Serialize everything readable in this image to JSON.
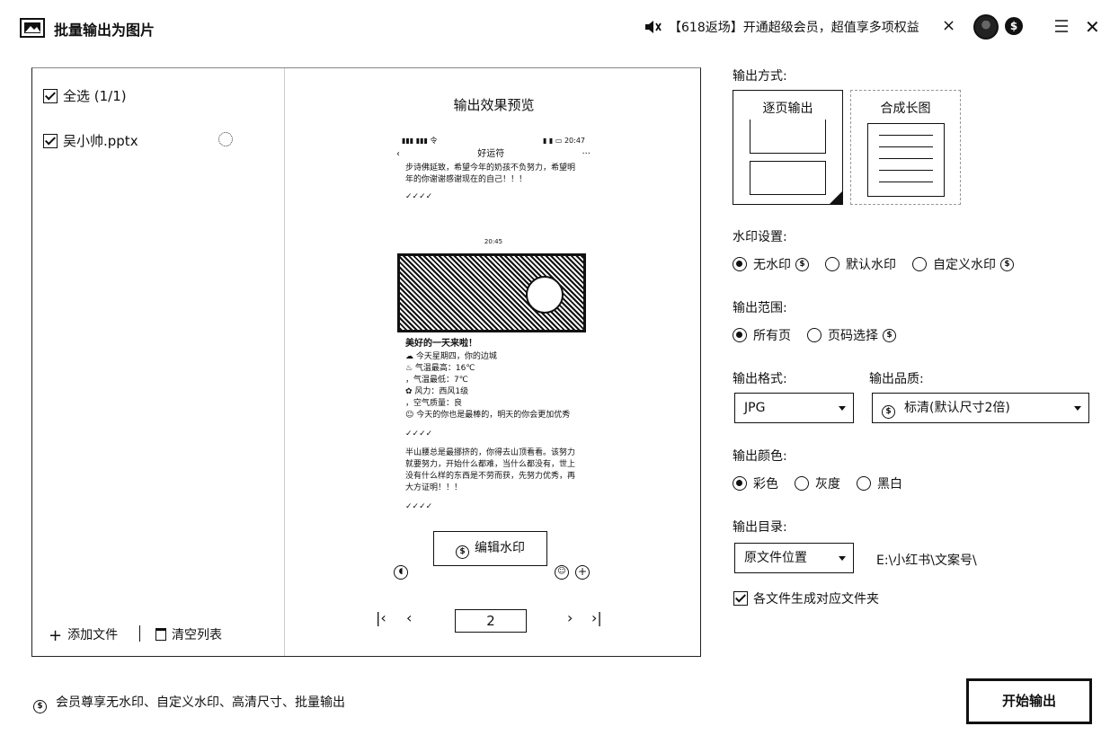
{
  "window": {
    "title": "批量输出为图片",
    "promo_text": "【618返场】开通超级会员，超值享多项权益",
    "promo_close": "×",
    "vip_badge": "$",
    "close": "✕"
  },
  "file_list": {
    "select_all_label": "全选 (1/1)",
    "files": [
      {
        "name": "吴小帅.pptx",
        "checked": true
      }
    ],
    "add_file_label": "添加文件",
    "clear_list_label": "清空列表"
  },
  "preview": {
    "title": "输出效果预览",
    "phone": {
      "status_left": "▮▮▮ ▮▮▮ 令",
      "status_right": "▮ ▮ ▭ 20:47",
      "back": "‹",
      "nav_title": "好运符",
      "more": "···",
      "para1": "步诗佛延致，希望今年的奶孩不负努力，希望明年的你谢谢感谢现在的自己！！！",
      "emoji1": "✓✓✓✓",
      "time_mid": "20:45",
      "heading": "美好的一天来啦！",
      "list": [
        "☁ 今天星期四，你的边城",
        "♨ 气温最高：16℃",
        "，气温最低：7℃",
        "✿ 风力：西风1级",
        "，空气质量：良",
        "☺ 今天的你也是最棒的，明天的你会更加优秀"
      ],
      "emoji2": "✓✓✓✓",
      "para2": "半山腰总是最挪挤的，你得去山顶看看。该努力就要努力，开始什么都难，当什么都没有，世上没有什么样的东西是不劳而获，先努力优秀，再大方证明！！！",
      "emoji3": "✓✓✓✓"
    },
    "edit_watermark_label": "编辑水印",
    "pager": {
      "first": "|‹",
      "prev": "‹",
      "current_page": "2",
      "next": "›",
      "last": "›|"
    }
  },
  "settings": {
    "output_mode_label": "输出方式:",
    "modes": [
      {
        "label": "逐页输出",
        "selected": true
      },
      {
        "label": "合成长图",
        "selected": false
      }
    ],
    "watermark_label": "水印设置:",
    "watermark_options": [
      {
        "label": "无水印",
        "selected": true,
        "vip": true
      },
      {
        "label": "默认水印",
        "selected": false,
        "vip": false
      },
      {
        "label": "自定义水印",
        "selected": false,
        "vip": true
      }
    ],
    "range_label": "输出范围:",
    "range_options": [
      {
        "label": "所有页",
        "selected": true,
        "vip": false
      },
      {
        "label": "页码选择",
        "selected": false,
        "vip": true
      }
    ],
    "format_label": "输出格式:",
    "format_value": "JPG",
    "quality_label": "输出品质:",
    "quality_value": "标清(默认尺寸2倍)",
    "color_label": "输出颜色:",
    "color_options": [
      {
        "label": "彩色",
        "selected": true
      },
      {
        "label": "灰度",
        "selected": false
      },
      {
        "label": "黑白",
        "selected": false
      }
    ],
    "dir_label": "输出目录:",
    "dir_value": "原文件位置",
    "dir_path": "E:\\小红书\\文案号\\",
    "subfolder_label": "各文件生成对应文件夹",
    "subfolder_checked": true
  },
  "footer": {
    "vip_note": "会员尊享无水印、自定义水印、高清尺寸、批量输出",
    "start_label": "开始输出"
  },
  "icons": {
    "coin": "$"
  }
}
